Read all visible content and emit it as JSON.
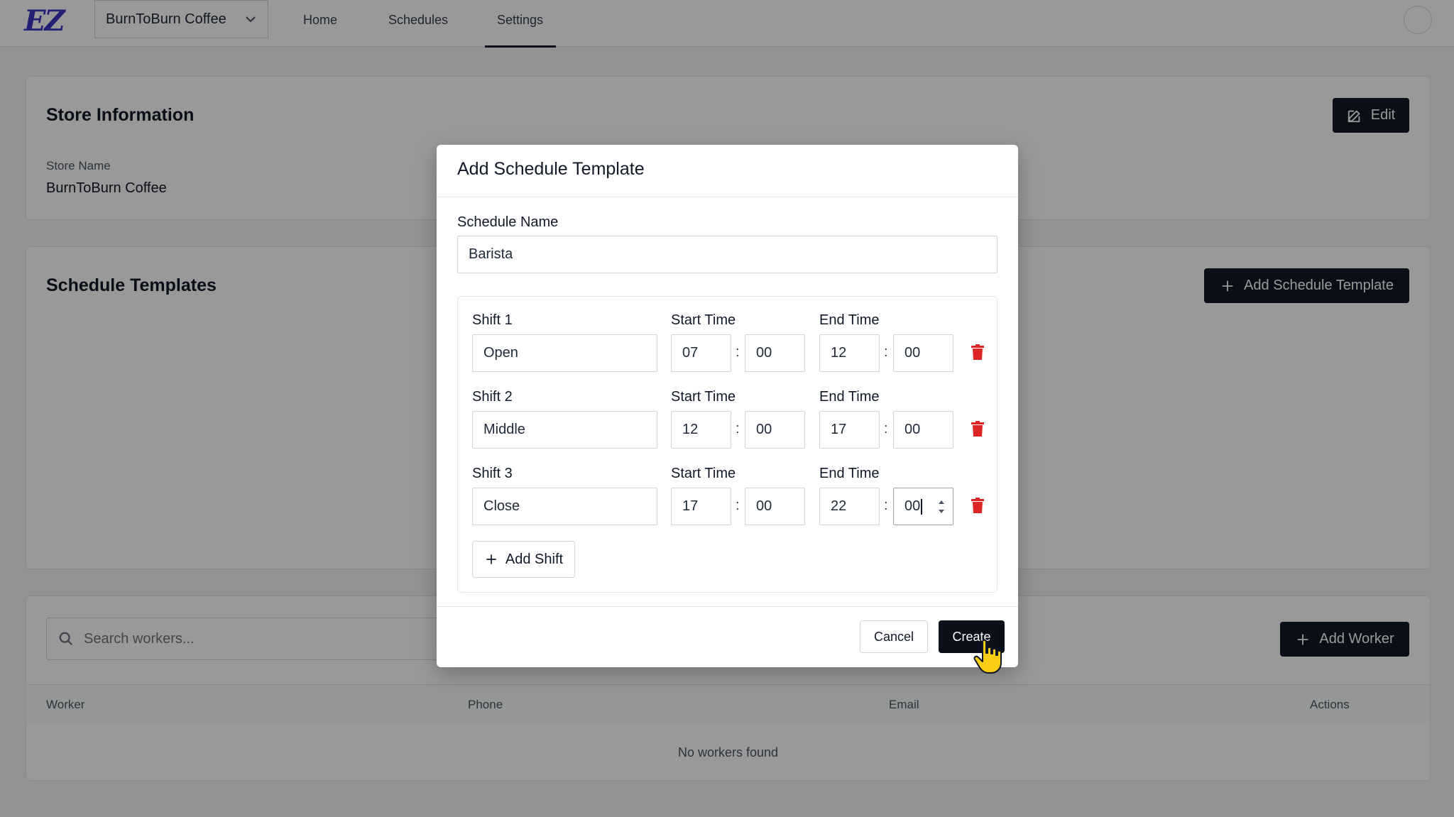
{
  "app": {
    "logo": "EZ",
    "store_selector": "BurnToBurn Coffee",
    "nav": [
      {
        "label": "Home"
      },
      {
        "label": "Schedules"
      },
      {
        "label": "Settings"
      }
    ],
    "active_nav": "Settings"
  },
  "store_info": {
    "title": "Store Information",
    "edit_label": "Edit",
    "store_name_label": "Store Name",
    "store_name_value": "BurnToBurn Coffee"
  },
  "schedule_templates": {
    "title": "Schedule Templates",
    "add_label": "Add Schedule Template"
  },
  "workers": {
    "search_placeholder": "Search workers...",
    "add_label": "Add Worker",
    "columns": [
      "Worker",
      "Phone",
      "Email",
      "Actions"
    ],
    "empty_message": "No workers found"
  },
  "modal": {
    "title": "Add Schedule Template",
    "schedule_name_label": "Schedule Name",
    "schedule_name_value": "Barista",
    "start_time_label": "Start Time",
    "end_time_label": "End Time",
    "shifts": [
      {
        "label": "Shift 1",
        "name": "Open",
        "start_h": "07",
        "start_m": "00",
        "end_h": "12",
        "end_m": "00"
      },
      {
        "label": "Shift 2",
        "name": "Middle",
        "start_h": "12",
        "start_m": "00",
        "end_h": "17",
        "end_m": "00"
      },
      {
        "label": "Shift 3",
        "name": "Close",
        "start_h": "17",
        "start_m": "00",
        "end_h": "22",
        "end_m": "00"
      }
    ],
    "add_shift_label": "Add Shift",
    "cancel_label": "Cancel",
    "create_label": "Create"
  },
  "colors": {
    "brand": "#3b35c4",
    "primary_button": "#111827",
    "danger": "#dc2626"
  }
}
